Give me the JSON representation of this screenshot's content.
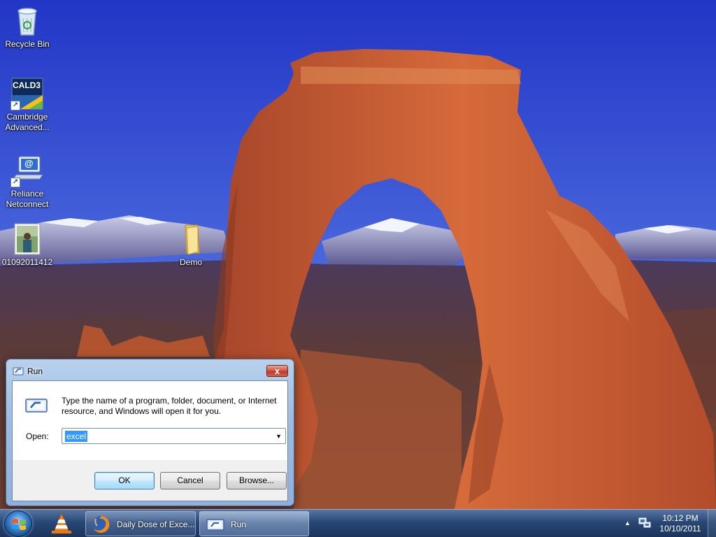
{
  "desktop": {
    "icons": [
      {
        "label": "Recycle Bin",
        "icon": "recycle-bin-icon"
      },
      {
        "label_line1": "Cambridge",
        "label_line2": "Advanced...",
        "badge": "CALD3",
        "icon": "dictionary-shortcut-icon"
      },
      {
        "label_line1": "Reliance",
        "label_line2": "Netconnect",
        "badge": "@",
        "icon": "network-connection-shortcut-icon"
      },
      {
        "label": "01092011412",
        "icon": "photo-thumbnail-icon"
      },
      {
        "label": "Demo",
        "icon": "folder-icon"
      }
    ]
  },
  "run_dialog": {
    "title": "Run",
    "close_label": "x",
    "description": "Type the name of a program, folder, document, or Internet resource, and Windows will open it for you.",
    "open_label": "Open:",
    "open_value": "excel",
    "buttons": {
      "ok": "OK",
      "cancel": "Cancel",
      "browse": "Browse..."
    }
  },
  "taskbar": {
    "pinned": [
      "vlc-icon"
    ],
    "tasks": [
      {
        "label": "Daily Dose of Exce...",
        "icon": "firefox-icon"
      },
      {
        "label": "Run",
        "icon": "run-icon",
        "active": true
      }
    ],
    "tray": {
      "chevron": "▲",
      "network_icon": "network-icon"
    },
    "clock": {
      "time": "10:12 PM",
      "date": "10/10/2011"
    }
  },
  "colors": {
    "sky": "#2f44c6",
    "rock": "#c7562c",
    "taskbar": "#284670",
    "selection": "#3399ff"
  }
}
